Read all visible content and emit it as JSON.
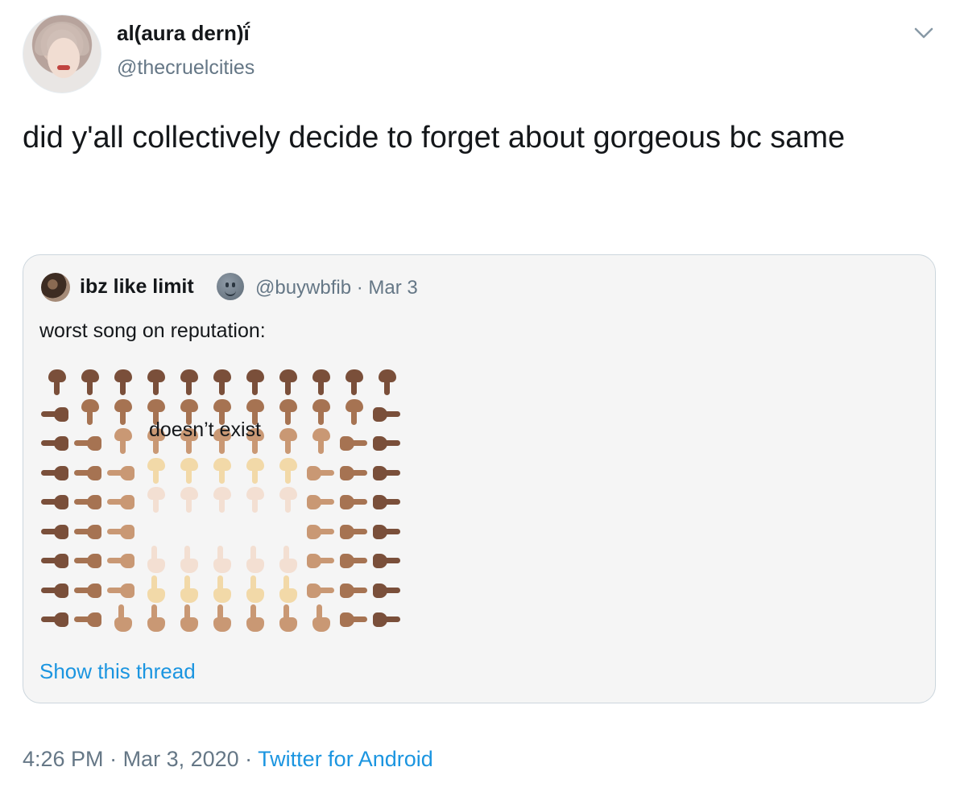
{
  "author": {
    "display_name": "al(aura dern)ḯ",
    "handle": "@thecruelcities"
  },
  "tweet": {
    "text": "did y'all collectively decide to forget about gorgeous bc same"
  },
  "quoted": {
    "display_name": "ibz like limit",
    "handle": "@buywbfib",
    "separator": " · ",
    "date": "Mar 3",
    "text": "worst song on reputation:",
    "center_label": "doesn’t exist",
    "show_thread": "Show this thread"
  },
  "meta": {
    "time": "4:26 PM",
    "separator": " · ",
    "date": "Mar 3, 2020",
    "source": "Twitter for Android"
  },
  "icons": {
    "menu": "chevron-down-icon",
    "verified_like": "neutral-face-emoji-icon"
  },
  "skin_tones": {
    "d": "#7a4f3a",
    "md": "#a67352",
    "m": "#c99874",
    "ml": "#e1bc8e",
    "l": "#f2d9a8",
    "vl": "#f3dfd2"
  },
  "grid": [
    [
      "down:d",
      "down:d",
      "down:d",
      "down:d",
      "down:d",
      "down:d",
      "down:d",
      "down:d",
      "down:d",
      "down:d",
      "down:d"
    ],
    [
      "left:d",
      "down:md",
      "down:md",
      "down:md",
      "down:md",
      "down:md",
      "down:md",
      "down:md",
      "down:md",
      "down:md",
      "right:d"
    ],
    [
      "left:d",
      "left:md",
      "down:m",
      "down:m",
      "down:m",
      "down:m",
      "down:m",
      "down:m",
      "down:m",
      "right:md",
      "right:d"
    ],
    [
      "left:d",
      "left:md",
      "left:m",
      "down:l",
      "down:l",
      "down:l",
      "down:l",
      "down:l",
      "right:m",
      "right:md",
      "right:d"
    ],
    [
      "left:d",
      "left:md",
      "left:m",
      "down:vl",
      "down:vl",
      "down:vl",
      "down:vl",
      "down:vl",
      "right:m",
      "right:md",
      "right:d"
    ],
    [
      "left:d",
      "left:md",
      "left:m",
      "",
      "",
      "",
      "",
      "",
      "right:m",
      "right:md",
      "right:d"
    ],
    [
      "left:d",
      "left:md",
      "left:m",
      "up:vl",
      "up:vl",
      "up:vl",
      "up:vl",
      "up:vl",
      "right:m",
      "right:md",
      "right:d"
    ],
    [
      "left:d",
      "left:md",
      "left:m",
      "up:l",
      "up:l",
      "up:l",
      "up:l",
      "up:l",
      "right:m",
      "right:md",
      "right:d"
    ],
    [
      "left:d",
      "left:md",
      "up:m",
      "up:m",
      "up:m",
      "up:m",
      "up:m",
      "up:m",
      "up:m",
      "right:md",
      "right:d"
    ]
  ]
}
